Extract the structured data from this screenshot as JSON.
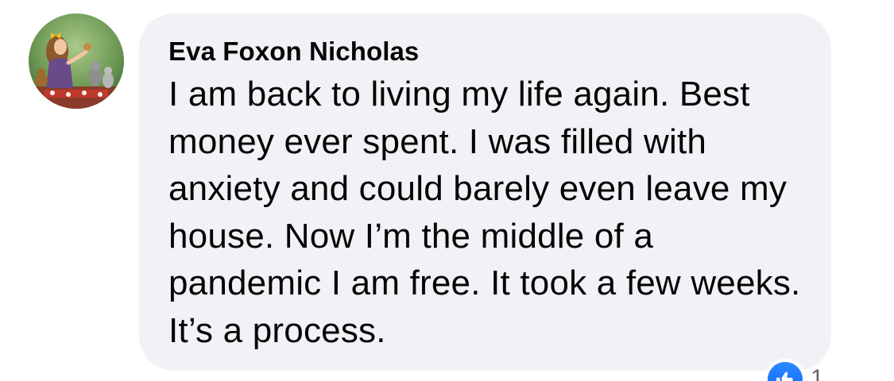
{
  "comment": {
    "author": "Eva Foxon Nicholas",
    "text": "I am back to living my life again. Best money ever spent. I was filled with anxiety and could barely even leave my house. Now I’m the middle of a pandemic I am free. It took a few weeks. It’s a process."
  },
  "reactions": {
    "icon": "thumbs-up-icon",
    "count": "1",
    "color": "#0866ff"
  },
  "colors": {
    "bubble": "#f0f2f5",
    "text": "#050505"
  }
}
